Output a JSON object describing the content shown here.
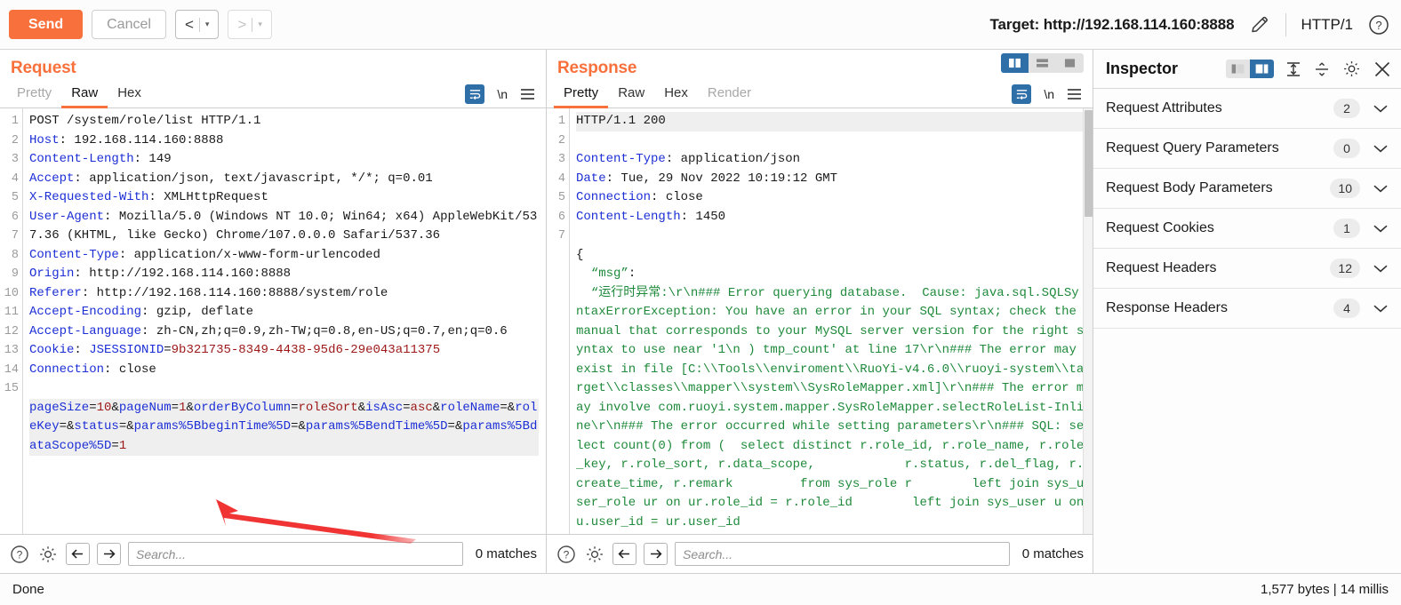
{
  "toolbar": {
    "send_label": "Send",
    "cancel_label": "Cancel",
    "prev_glyph": "<",
    "next_glyph": ">",
    "caret_glyph": "▾",
    "target_label": "Target: http://192.168.114.160:8888",
    "edit_icon": "pencil-icon",
    "http_version": "HTTP/1",
    "help_icon": "question-circle-icon",
    "accent_color": "#f8713c"
  },
  "request": {
    "title": "Request",
    "tabs": [
      {
        "label": "Pretty",
        "active": false,
        "disabled": true
      },
      {
        "label": "Raw",
        "active": true,
        "disabled": false
      },
      {
        "label": "Hex",
        "active": false,
        "disabled": false
      }
    ],
    "tools": {
      "wrap_icon": "word-wrap-icon",
      "newline_label": "\\n",
      "menu_icon": "hamburger-menu-icon"
    },
    "line_numbers": [
      "1",
      "2",
      "3",
      "4",
      "5",
      "6",
      "",
      "",
      "7",
      "8",
      "9",
      "10",
      "11",
      "",
      "12",
      "13",
      "14",
      "15",
      "",
      ""
    ],
    "lines": [
      {
        "text": "POST /system/role/list HTTP/1.1"
      },
      {
        "header": "Host",
        "value": " 192.168.114.160:8888"
      },
      {
        "header": "Content-Length",
        "value": " 149"
      },
      {
        "header": "Accept",
        "value": " application/json, text/javascript, */*; q=0.01"
      },
      {
        "header": "X-Requested-With",
        "value": " XMLHttpRequest"
      },
      {
        "header": "User-Agent",
        "value": " Mozilla/5.0 (Windows NT 10.0; Win64; x64) AppleWebKit/537.36 (KHTML, like Gecko) Chrome/107.0.0.0 Safari/537.36"
      },
      {
        "header": "Content-Type",
        "value": " application/x-www-form-urlencoded"
      },
      {
        "header": "Origin",
        "value": " http://192.168.114.160:8888"
      },
      {
        "header": "Referer",
        "value": " http://192.168.114.160:8888/system/role"
      },
      {
        "header": "Accept-Encoding",
        "value": " gzip, deflate"
      },
      {
        "header": "Accept-Language",
        "value": " zh-CN,zh;q=0.9,zh-TW;q=0.8,en-US;q=0.7,en;q=0.6"
      },
      {
        "header": "Cookie",
        "cookie_name": " JSESSIONID",
        "cookie_value": "9b321735-8349-4438-95d6-29e043a11375"
      },
      {
        "header": "Connection",
        "value": " close"
      },
      {
        "text": ""
      }
    ],
    "body_params": [
      {
        "name": "pageSize",
        "value": "10"
      },
      {
        "name": "pageNum",
        "value": "1"
      },
      {
        "name": "orderByColumn",
        "value": "roleSort"
      },
      {
        "name": "isAsc",
        "value": "asc"
      },
      {
        "name": "roleName",
        "value": ""
      },
      {
        "name": "roleKey",
        "value": ""
      },
      {
        "name": "status",
        "value": ""
      },
      {
        "name": "params%5BbeginTime%5D",
        "value": ""
      },
      {
        "name": "params%5BendTime%5D",
        "value": ""
      },
      {
        "name": "params%5BdataScope%5D",
        "value": "1"
      }
    ],
    "search": {
      "placeholder": "Search...",
      "value": "",
      "matches": "0 matches",
      "help_icon": "question-circle-icon",
      "settings_icon": "gear-icon",
      "prev_icon": "arrow-left-icon",
      "next_icon": "arrow-right-icon"
    }
  },
  "response": {
    "title": "Response",
    "tabs": [
      {
        "label": "Pretty",
        "active": true,
        "disabled": false
      },
      {
        "label": "Raw",
        "active": false,
        "disabled": false
      },
      {
        "label": "Hex",
        "active": false,
        "disabled": false
      },
      {
        "label": "Render",
        "active": false,
        "disabled": true
      }
    ],
    "tools": {
      "wrap_icon": "word-wrap-icon",
      "newline_label": "\\n",
      "menu_icon": "hamburger-menu-icon"
    },
    "layout_toggle": [
      {
        "name": "split-vertical",
        "active": true
      },
      {
        "name": "split-horizontal",
        "active": false
      },
      {
        "name": "single-pane",
        "active": false
      }
    ],
    "line_numbers": [
      "1",
      "2",
      "3",
      "4",
      "5",
      "6",
      "7"
    ],
    "status_line": "HTTP/1.1 200",
    "headers": [
      {
        "header": "Content-Type",
        "value": " application/json"
      },
      {
        "header": "Date",
        "value": " Tue, 29 Nov 2022 10:19:12 GMT"
      },
      {
        "header": "Connection",
        "value": " close"
      },
      {
        "header": "Content-Length",
        "value": " 1450"
      }
    ],
    "json_open": "{",
    "json_key": "“msg”",
    "json_value": "“运行时异常:\\r\\n### Error querying database.  Cause: java.sql.SQLSyntaxErrorException: You have an error in your SQL syntax; check the manual that corresponds to your MySQL server version for the right syntax to use near '1\\n ) tmp_count' at line 17\\r\\n### The error may exist in file [C:\\\\Tools\\\\enviroment\\\\RuoYi-v4.6.0\\\\ruoyi-system\\\\target\\\\classes\\\\mapper\\\\system\\\\SysRoleMapper.xml]\\r\\n### The error may involve com.ruoyi.system.mapper.SysRoleMapper.selectRoleList-Inline\\r\\n### The error occurred while setting parameters\\r\\n### SQL: select count(0) from (  select distinct r.role_id, r.role_name, r.role_key, r.role_sort, r.data_scope,            r.status, r.del_flag, r.create_time, r.remark         from sys_role r        left join sys_user_role ur on ur.role_id = r.role_id        left join sys_user u on u.user_id = ur.user_id",
    "search": {
      "placeholder": "Search...",
      "value": "",
      "matches": "0 matches",
      "help_icon": "question-circle-icon",
      "settings_icon": "gear-icon",
      "prev_icon": "arrow-left-icon",
      "next_icon": "arrow-right-icon"
    }
  },
  "inspector": {
    "title": "Inspector",
    "layout_toggle": [
      {
        "name": "panel-left",
        "active": false
      },
      {
        "name": "panel-right",
        "active": true
      }
    ],
    "expand_all_icon": "expand-all-icon",
    "collapse_all_icon": "collapse-all-icon",
    "settings_icon": "gear-icon",
    "close_icon": "close-icon",
    "sections": [
      {
        "label": "Request Attributes",
        "count": "2"
      },
      {
        "label": "Request Query Parameters",
        "count": "0"
      },
      {
        "label": "Request Body Parameters",
        "count": "10"
      },
      {
        "label": "Request Cookies",
        "count": "1"
      },
      {
        "label": "Request Headers",
        "count": "12"
      },
      {
        "label": "Response Headers",
        "count": "4"
      }
    ]
  },
  "statusbar": {
    "left": "Done",
    "right": "1,577 bytes | 14 millis"
  },
  "annotation": {
    "name": "red-arrow-annotation",
    "color": "#f03434"
  }
}
